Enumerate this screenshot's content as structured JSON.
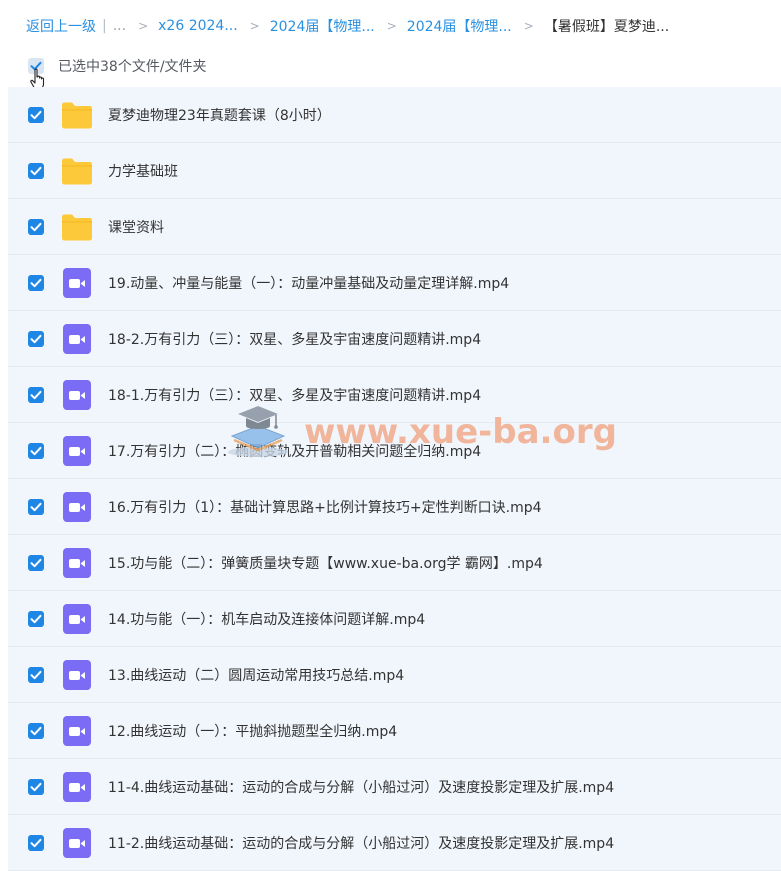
{
  "breadcrumb": {
    "back_label": "返回上一级",
    "ellipsis": "...",
    "items": [
      "x26 2024...",
      "2024届【物理...",
      "2024届【物理...",
      "【暑假班】夏梦迪..."
    ]
  },
  "selection": {
    "label": "已选中38个文件/文件夹",
    "checked": true
  },
  "files": [
    {
      "type": "folder",
      "name": "夏梦迪物理23年真题套课（8小时）"
    },
    {
      "type": "folder",
      "name": "力学基础班"
    },
    {
      "type": "folder",
      "name": "课堂资料"
    },
    {
      "type": "video",
      "name": "19.动量、冲量与能量（一）：动量冲量基础及动量定理详解.mp4"
    },
    {
      "type": "video",
      "name": "18-2.万有引力（三）：双星、多星及宇宙速度问题精讲.mp4"
    },
    {
      "type": "video",
      "name": "18-1.万有引力（三）：双星、多星及宇宙速度问题精讲.mp4"
    },
    {
      "type": "video",
      "name": "17.万有引力（二）：椭圆变轨及开普勒相关问题全归纳.mp4"
    },
    {
      "type": "video",
      "name": "16.万有引力（1）：基础计算思路+比例计算技巧+定性判断口诀.mp4"
    },
    {
      "type": "video",
      "name": "15.功与能（二）：弹簧质量块专题【www.xue-ba.org学 霸网】.mp4"
    },
    {
      "type": "video",
      "name": "14.功与能（一）：机车启动及连接体问题详解.mp4"
    },
    {
      "type": "video",
      "name": "13.曲线运动（二）圆周运动常用技巧总结.mp4"
    },
    {
      "type": "video",
      "name": "12.曲线运动（一）：平抛斜抛题型全归纳.mp4"
    },
    {
      "type": "video",
      "name": "11-4.曲线运动基础：运动的合成与分解（小船过河）及速度投影定理及扩展.mp4"
    },
    {
      "type": "video",
      "name": "11-2.曲线运动基础：运动的合成与分解（小船过河）及速度投影定理及扩展.mp4"
    }
  ],
  "watermark": {
    "text": "www.xue-ba.org"
  },
  "colors": {
    "accent": "#1f86e5",
    "link": "#2a90e0",
    "folder": "#fcc93a",
    "video": "#7b6cf6",
    "list_bg": "#f1f6fc",
    "watermark": "#f0a37f"
  }
}
